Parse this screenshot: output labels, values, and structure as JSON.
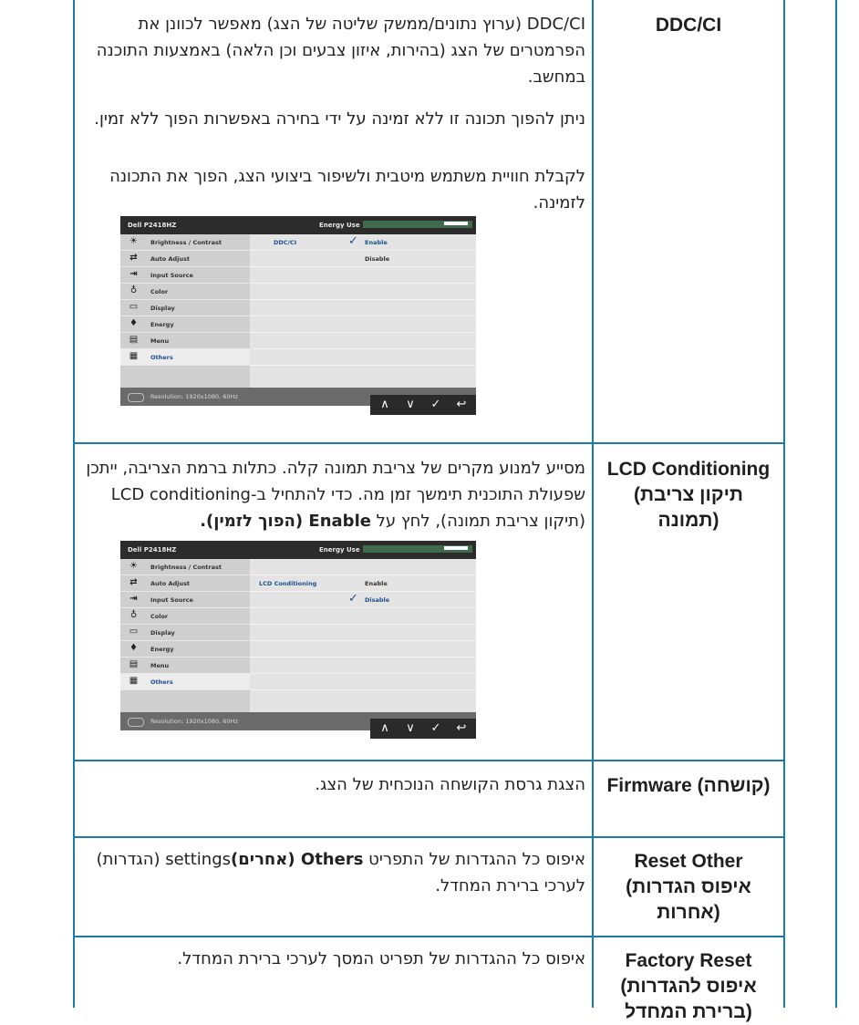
{
  "rows": [
    {
      "label": "DDC/CI",
      "paragraphs": [
        "DDC/CI (ערוץ נתונים/ממשק שליטה של הצג) מאפשר לכוונן את הפרמטרים של הצג (בהירות, איזון צבעים וכן הלאה) באמצעות התוכנה במחשב.",
        "ניתן להפוך תכונה זו ללא זמינה על ידי בחירה באפשרות הפוך ללא זמין.",
        "לקבלת חוויית משתמש מיטבית ולשיפור ביצועי הצג, הפוך את התכונה לזמינה."
      ]
    },
    {
      "label": "LCD Conditioning (תיקון צריבת תמונה)",
      "paragraph_start": "מסייע למנוע מקרים של צריבת תמונה קלה. כתלות ברמת הצריבה, ייתכן שפעולת התוכנית תימשך זמן מה. כדי להתחיל ב-LCD conditioning (תיקון צריבת תמונה), לחץ על ",
      "paragraph_bold": "Enable (הפוך לזמין)."
    },
    {
      "label": "Firmware (קושחה)",
      "paragraph": "הצגת גרסת הקושחה הנוכחית של הצג."
    },
    {
      "label": "Reset Other (איפוס הגדרות אחרות)",
      "paragraph_start": "איפוס כל ההגדרות של התפריט ",
      "paragraph_bold": "Others (אחרים)",
      "paragraph_end": "settings (הגדרות) לערכי ברירת המחדל."
    },
    {
      "label": "Factory Reset (איפוס להגדרות ברירת המחדל)",
      "paragraph": "איפוס כל ההגדרות של תפריט המסך לערכי ברירת המחדל."
    }
  ],
  "osd": {
    "model": "Dell P2418HZ",
    "energy_label": "Energy Use",
    "menu": [
      {
        "label": "Brightness / Contrast",
        "icon": "sun-icon"
      },
      {
        "label": "Auto Adjust",
        "icon": "auto-adjust-icon"
      },
      {
        "label": "Input Source",
        "icon": "input-source-icon"
      },
      {
        "label": "Color",
        "icon": "color-icon"
      },
      {
        "label": "Display",
        "icon": "display-icon"
      },
      {
        "label": "Energy",
        "icon": "energy-icon"
      },
      {
        "label": "Menu",
        "icon": "menu-icon"
      },
      {
        "label": "Others",
        "icon": "others-icon"
      }
    ],
    "resolution": "Resolution: 1920x1080, 60Hz",
    "ddc": {
      "setting": "DDC/CI",
      "enable": "Enable",
      "disable": "Disable"
    },
    "lcd": {
      "setting": "LCD Conditioning",
      "enable": "Enable",
      "disable": "Disable"
    },
    "nav": {
      "up": "∧",
      "down": "∨",
      "ok": "✓",
      "back": "↩"
    }
  },
  "colors": {
    "border": "#1a7aa8",
    "osd_header": "#2c2c2c",
    "osd_accent": "#1d4f91"
  }
}
